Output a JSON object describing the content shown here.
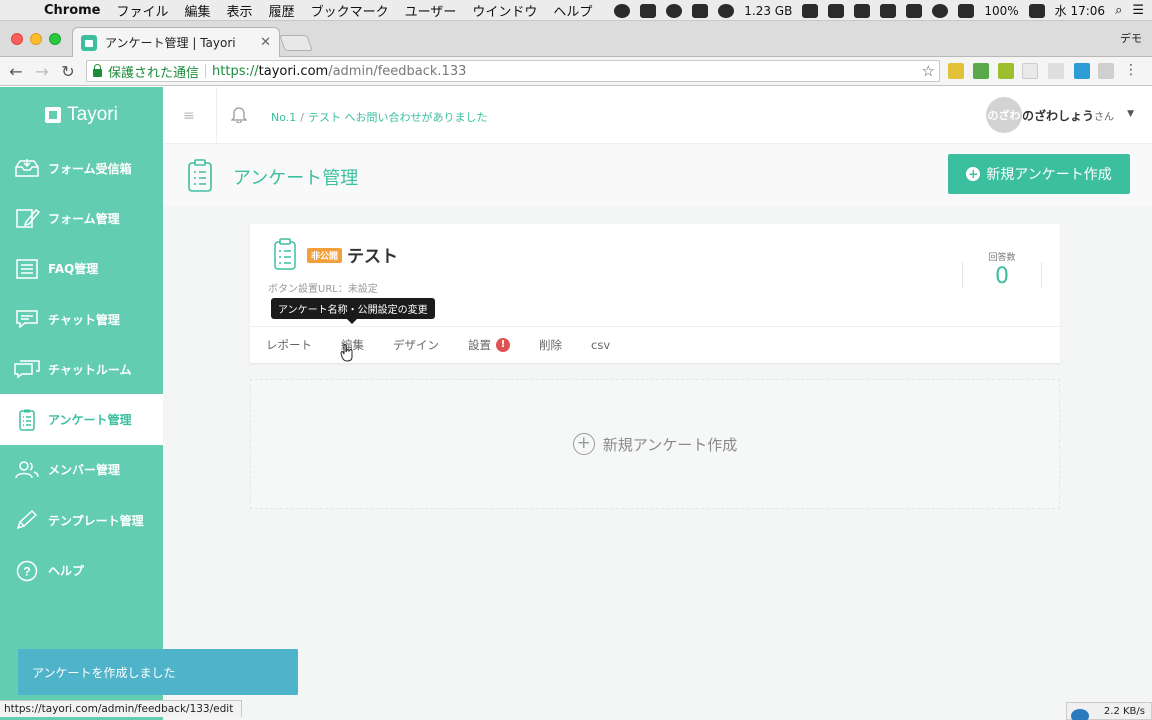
{
  "menubar": {
    "app": "Chrome",
    "items": [
      "ファイル",
      "編集",
      "表示",
      "履歴",
      "ブックマーク",
      "ユーザー",
      "ウインドウ",
      "ヘルプ"
    ],
    "memory": "1.23 GB",
    "battery": "100%",
    "clock": "水 17:06"
  },
  "browser": {
    "tab_title": "アンケート管理 | Tayori",
    "profile": "デモ",
    "secure_label": "保護された通信",
    "url_scheme": "https://",
    "url_host": "tayori.com",
    "url_path": "/admin/feedback.133",
    "status_url": "https://tayori.com/admin/feedback/133/edit",
    "net_speed": "2.2 KB/s"
  },
  "sidebar": {
    "logo": "Tayori",
    "items": [
      {
        "label": "フォーム受信箱",
        "icon": "inbox-icon"
      },
      {
        "label": "フォーム管理",
        "icon": "form-edit-icon"
      },
      {
        "label": "FAQ管理",
        "icon": "faq-icon"
      },
      {
        "label": "チャット管理",
        "icon": "chat-icon"
      },
      {
        "label": "チャットルーム",
        "icon": "chatroom-icon"
      },
      {
        "label": "アンケート管理",
        "icon": "survey-icon",
        "active": true
      },
      {
        "label": "メンバー管理",
        "icon": "members-icon"
      },
      {
        "label": "テンプレート管理",
        "icon": "template-icon"
      },
      {
        "label": "ヘルプ",
        "icon": "help-icon"
      }
    ]
  },
  "header": {
    "notice_no": "No.1",
    "notice_text": "テスト へお問い合わせがありました",
    "avatar_text": "のざわ",
    "user_name": "のざわしょう",
    "user_suffix": "さん"
  },
  "page": {
    "title": "アンケート管理",
    "new_button": "新規アンケート作成"
  },
  "survey_card": {
    "status_badge": "非公開",
    "title": "テスト",
    "button_url_label": "ボタン設置URL：未設定",
    "responses_label": "回答数",
    "responses_count": "0",
    "tabs": [
      "レポート",
      "編集",
      "デザイン",
      "設置",
      "削除",
      "csv"
    ],
    "tooltip": "アンケート名称・公開設定の変更"
  },
  "placeholder": {
    "label": "新規アンケート作成"
  },
  "toast": {
    "message": "アンケートを作成しました"
  },
  "colors": {
    "brand": "#62cdb1",
    "accent": "#3cbf9f",
    "warning": "#e05252",
    "toast": "#4fb3c9"
  }
}
